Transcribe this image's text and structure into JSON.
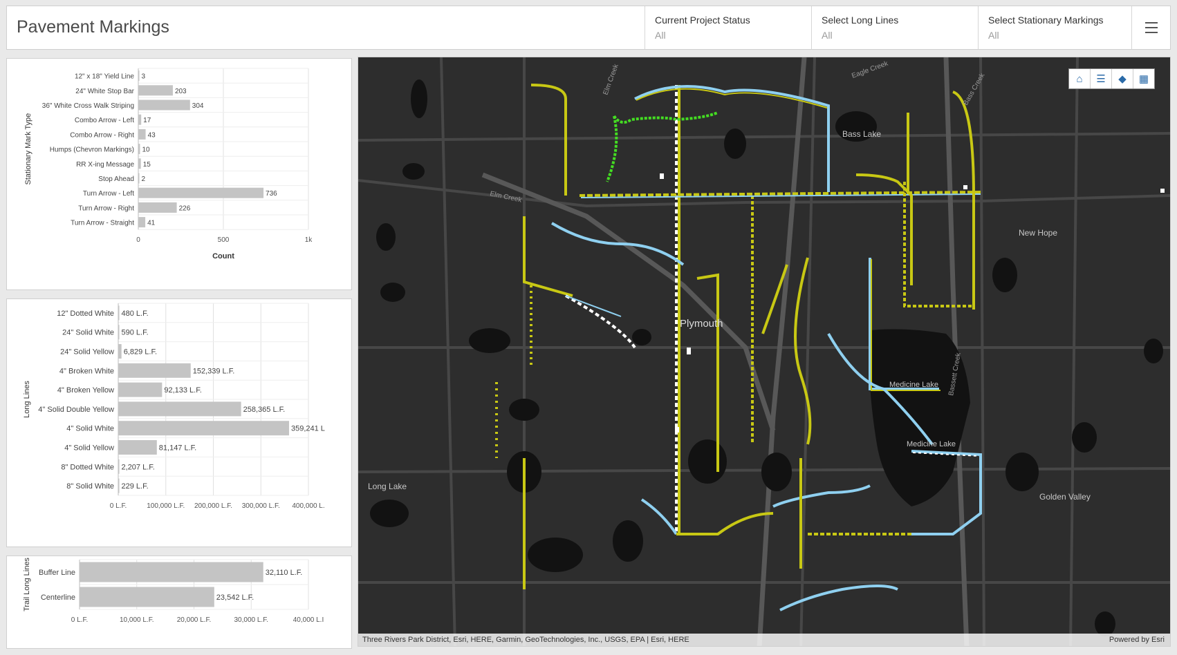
{
  "header": {
    "title": "Pavement Markings",
    "filters": [
      {
        "label": "Current Project Status",
        "value": "All"
      },
      {
        "label": "Select Long Lines",
        "value": "All"
      },
      {
        "label": "Select Stationary Markings",
        "value": "All"
      }
    ]
  },
  "chart_data": [
    {
      "type": "bar",
      "orientation": "horizontal",
      "ylabel": "Stationary Mark Type",
      "xlabel": "Count",
      "categories": [
        "12\" x 18\" Yield Line",
        "24\" White Stop Bar",
        "36\" White Cross Walk Striping",
        "Combo Arrow - Left",
        "Combo Arrow - Right",
        "Humps (Chevron Markings)",
        "RR X-ing Message",
        "Stop Ahead",
        "Turn Arrow - Left",
        "Turn Arrow - Right",
        "Turn Arrow - Straight"
      ],
      "values": [
        3,
        203,
        304,
        17,
        43,
        10,
        15,
        2,
        736,
        226,
        41
      ],
      "value_labels": [
        "3",
        "203",
        "304",
        "17",
        "43",
        "10",
        "15",
        "2",
        "736",
        "226",
        "41"
      ],
      "xlim": [
        0,
        1000
      ],
      "ticks": [
        {
          "v": 0,
          "label": "0"
        },
        {
          "v": 500,
          "label": "500"
        },
        {
          "v": 1000,
          "label": "1k"
        }
      ],
      "grid": true,
      "color": "#c4c4c4"
    },
    {
      "type": "bar",
      "orientation": "horizontal",
      "ylabel": "Long Lines",
      "xlabel": "",
      "categories": [
        "12\" Dotted White",
        "24\" Solid White",
        "24\" Solid Yellow",
        "4\" Broken White",
        "4\" Broken Yellow",
        "4\" Solid Double Yellow",
        "4\" Solid White",
        "4\" Solid Yellow",
        "8\" Dotted White",
        "8\" Solid White"
      ],
      "values": [
        480,
        590,
        6829,
        152339,
        92133,
        258365,
        359241,
        81147,
        2207,
        229
      ],
      "value_labels": [
        "480 L.F.",
        "590 L.F.",
        "6,829 L.F.",
        "152,339 L.F.",
        "92,133 L.F.",
        "258,365 L.F.",
        "359,241 L",
        "81,147 L.F.",
        "2,207 L.F.",
        "229 L.F."
      ],
      "xlim": [
        0,
        400000
      ],
      "ticks": [
        {
          "v": 0,
          "label": "0 L.F."
        },
        {
          "v": 100000,
          "label": "100,000 L.F."
        },
        {
          "v": 200000,
          "label": "200,000 L.F."
        },
        {
          "v": 300000,
          "label": "300,000 L.F."
        },
        {
          "v": 400000,
          "label": "400,000 L."
        }
      ],
      "grid": true,
      "color": "#c4c4c4"
    },
    {
      "type": "bar",
      "orientation": "horizontal",
      "ylabel": "Trail Long Lines",
      "xlabel": "",
      "categories": [
        "Buffer Line",
        "Centerline"
      ],
      "values": [
        32110,
        23542
      ],
      "value_labels": [
        "32,110 L.F.",
        "23,542 L.F."
      ],
      "xlim": [
        0,
        40000
      ],
      "ticks": [
        {
          "v": 0,
          "label": "0 L.F."
        },
        {
          "v": 10000,
          "label": "10,000 L.F."
        },
        {
          "v": 20000,
          "label": "20,000 L.F."
        },
        {
          "v": 30000,
          "label": "30,000 L.F."
        },
        {
          "v": 40000,
          "label": "40,000 L.I"
        }
      ],
      "grid": true,
      "color": "#c4c4c4"
    }
  ],
  "map": {
    "places": [
      {
        "name": "Bass Lake"
      },
      {
        "name": "New Hope"
      },
      {
        "name": "Plymouth"
      },
      {
        "name": "Medicine Lake"
      },
      {
        "name": "Medicine Lake"
      },
      {
        "name": "Long Lake"
      },
      {
        "name": "Golden Valley"
      },
      {
        "name": "Elm Creek"
      },
      {
        "name": "Elm Creek"
      },
      {
        "name": "Eagle Creek"
      },
      {
        "name": "Bass Creek"
      },
      {
        "name": "Bassett Creek"
      }
    ],
    "tools": [
      "home-icon",
      "legend-icon",
      "layers-icon",
      "basemap-icon"
    ],
    "colors": {
      "background": "#2d2d2d",
      "water": "#0f0f0f",
      "road": "#4a4a4a",
      "yellow_line": "#c8c814",
      "blue_line": "#8fd0f0",
      "green_line": "#44dd22",
      "white_line": "#ffffff"
    },
    "attribution": "Three Rivers Park District, Esri, HERE, Garmin, GeoTechnologies, Inc., USGS, EPA | Esri, HERE",
    "powered_by": "Powered by Esri"
  }
}
